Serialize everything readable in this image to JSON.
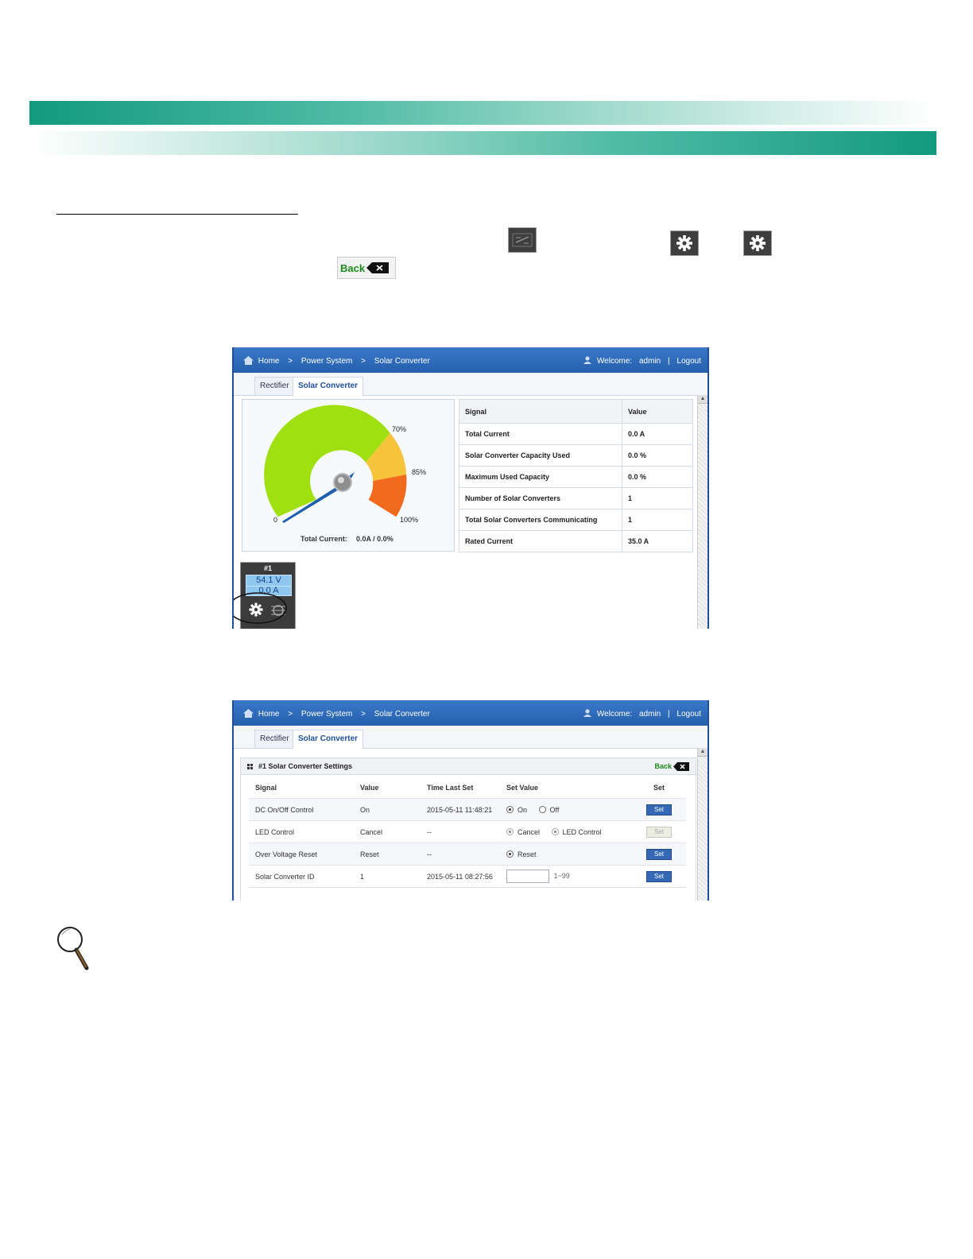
{
  "document": {
    "back_button_label": "Back"
  },
  "shot1": {
    "breadcrumb": [
      "Home",
      ">",
      "Power System",
      ">",
      "Solar Converter"
    ],
    "welcome_label": "Welcome:",
    "user": "admin",
    "separator": "|",
    "logout": "Logout",
    "tabs": [
      "Rectifier",
      "Solar Converter"
    ],
    "gauge": {
      "labels": {
        "p70": "70%",
        "p85": "85%",
        "p100": "100%",
        "zero": "0"
      },
      "caption_label": "Total Current:",
      "caption_value": "0.0A / 0.0%",
      "level_percent": 0,
      "colors": {
        "green": "#a0e010",
        "yellow": "#f6c43a",
        "orange": "#f06a1e",
        "needle": "#1f5fb0"
      }
    },
    "table": {
      "header": [
        "Signal",
        "Value"
      ],
      "rows": [
        [
          "Total Current",
          "0.0 A"
        ],
        [
          "Solar Converter Capacity Used",
          "0.0 %"
        ],
        [
          "Maximum Used Capacity",
          "0.0 %"
        ],
        [
          "Number of Solar Converters",
          "1"
        ],
        [
          "Total Solar Converters Communicating",
          "1"
        ],
        [
          "Rated Current",
          "35.0 A"
        ]
      ]
    },
    "module": {
      "number": "#1",
      "voltage": "54.1 V",
      "current": "0.0 A"
    }
  },
  "shot2": {
    "breadcrumb": [
      "Home",
      ">",
      "Power System",
      ">",
      "Solar Converter"
    ],
    "welcome_label": "Welcome:",
    "user": "admin",
    "separator": "|",
    "logout": "Logout",
    "tabs": [
      "Rectifier",
      "Solar Converter"
    ],
    "panel_title": "#1 Solar Converter Settings",
    "back_label": "Back",
    "headers": [
      "Signal",
      "Value",
      "Time Last Set",
      "Set Value",
      "Set"
    ],
    "rows": [
      {
        "signal": "DC On/Off Control",
        "value": "On",
        "time": "2015-05-11 11:48:21",
        "opt1": "On",
        "opt2": "Off",
        "button": "Set"
      },
      {
        "signal": "LED Control",
        "value": "Cancel",
        "time": "--",
        "opt1": "Cancel",
        "opt2": "LED Control",
        "button": "Set"
      },
      {
        "signal": "Over Voltage Reset",
        "value": "Reset",
        "time": "--",
        "opt1": "Reset",
        "button": "Set"
      },
      {
        "signal": "Solar Converter ID",
        "value": "1",
        "time": "2015-05-11 08:27:56",
        "range": "1~99",
        "button": "Set"
      }
    ]
  }
}
